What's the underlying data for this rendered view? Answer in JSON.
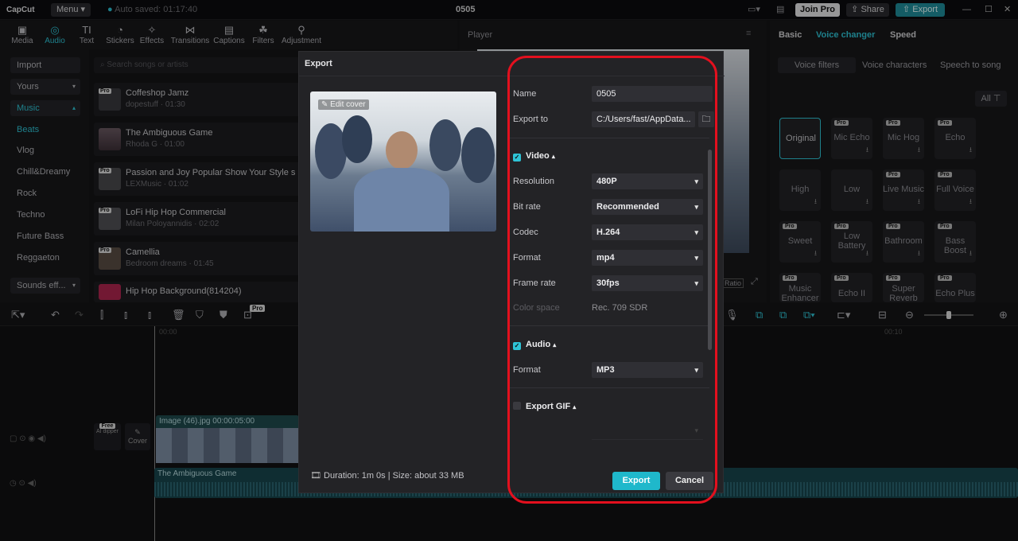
{
  "titlebar": {
    "app": "CapCut",
    "menu": "Menu",
    "autosave": "Auto saved: 01:17:40",
    "project": "0505",
    "join_pro": "Join Pro",
    "share": "Share",
    "export": "Export"
  },
  "toolbar": {
    "tools": [
      "Media",
      "Audio",
      "Text",
      "Stickers",
      "Effects",
      "Transitions",
      "Captions",
      "Filters",
      "Adjustment"
    ]
  },
  "leftnav": {
    "items": [
      "Import",
      "Yours",
      "Music",
      "Beats",
      "Vlog",
      "Chill&Dreamy",
      "Rock",
      "Techno",
      "Future Bass",
      "Reggaeton",
      "Sounds eff..."
    ]
  },
  "search": {
    "placeholder": "Search songs or artists"
  },
  "songs": [
    {
      "title": "Coffeshop Jamz",
      "sub": "dopestuff · 01:30"
    },
    {
      "title": "The Ambiguous Game",
      "sub": "Rhoda G · 01:00"
    },
    {
      "title": "Passion and Joy Popular Show Your Style s",
      "sub": "LEXMusic · 01:02"
    },
    {
      "title": "LoFi Hip Hop Commercial",
      "sub": "Milan Poloyannidis · 02:02"
    },
    {
      "title": "Camellia",
      "sub": "Bedroom dreams · 01:45"
    },
    {
      "title": "Hip Hop Background(814204)",
      "sub": ""
    }
  ],
  "player": {
    "label": "Player",
    "ratio": "Ratio"
  },
  "right": {
    "tabs": [
      "Basic",
      "Voice changer",
      "Speed"
    ],
    "subtabs": [
      "Voice filters",
      "Voice characters",
      "Speech to song"
    ],
    "filter_all": "All",
    "voices": [
      "Original",
      "Mic Echo",
      "Mic Hog",
      "Echo",
      "High",
      "Low",
      "Live Music",
      "Full Voice",
      "Sweet",
      "Low Battery",
      "Bathroom",
      "Bass Boost",
      "Music Enhancer",
      "Echo II",
      "Super Reverb",
      "Echo Plus"
    ]
  },
  "timeline": {
    "time0": "00:00",
    "time1": "00:10",
    "clip1": "Image (46).jpg  00:00:05:00",
    "clip2": "The Ambiguous Game",
    "cover": "Cover",
    "free": "Free",
    "ai_dipper": "AI dipper",
    "pro": "Pro"
  },
  "dialog": {
    "title": "Export",
    "edit_cover": "Edit cover",
    "name_label": "Name",
    "name_value": "0505",
    "export_to_label": "Export to",
    "export_to_value": "C:/Users/fast/AppData...",
    "video_label": "Video",
    "resolution_label": "Resolution",
    "resolution_value": "480P",
    "bitrate_label": "Bit rate",
    "bitrate_value": "Recommended",
    "codec_label": "Codec",
    "codec_value": "H.264",
    "format_label": "Format",
    "format_value": "mp4",
    "framerate_label": "Frame rate",
    "framerate_value": "30fps",
    "colorspace_label": "Color space",
    "colorspace_value": "Rec. 709 SDR",
    "audio_label": "Audio",
    "audio_format_label": "Format",
    "audio_format_value": "MP3",
    "gif_label": "Export GIF",
    "duration": "Duration: 1m 0s | Size: about 33 MB",
    "export_button": "Export",
    "cancel_button": "Cancel"
  },
  "colors": {
    "accent": "#2ec4d6",
    "highlight": "#e3101e"
  }
}
